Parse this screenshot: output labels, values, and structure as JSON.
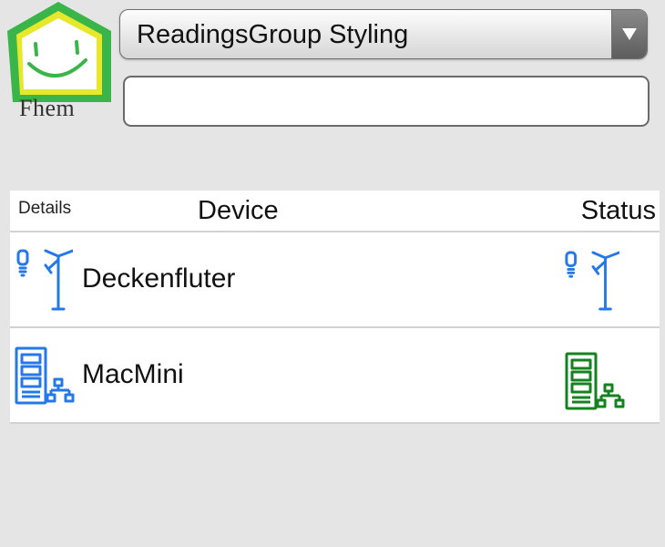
{
  "logo": {
    "text": "Fhem",
    "icon": "smiling-house-logo"
  },
  "room_select": {
    "selected": "ReadingsGroup Styling",
    "icon": "chevron-down-icon"
  },
  "command_input": {
    "value": "",
    "placeholder": ""
  },
  "table": {
    "headers": {
      "details": "Details",
      "device": "Device",
      "status": "Status"
    },
    "rows": [
      {
        "name": "Deckenfluter",
        "icon": "floor-lamp-icon",
        "status_icon": "floor-lamp-icon",
        "status_color": "#2478e8"
      },
      {
        "name": "MacMini",
        "icon": "server-network-icon",
        "status_icon": "server-network-icon",
        "status_color": "#14821e"
      }
    ]
  },
  "colors": {
    "background": "#e5e5e5",
    "icon_blue": "#2478e8",
    "status_green": "#14821e",
    "logo_green": "#39b54a",
    "logo_yellow": "#e8e82a"
  }
}
